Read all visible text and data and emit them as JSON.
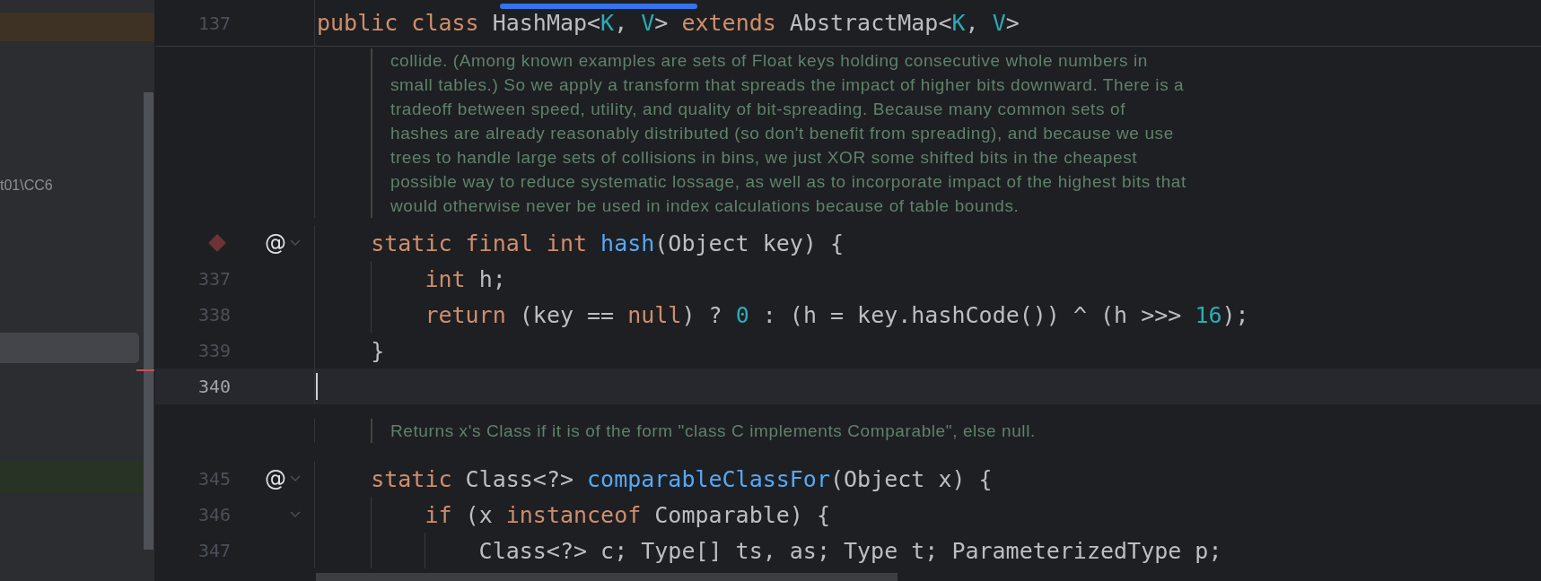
{
  "sidebar": {
    "path_text": "t01\\CC6"
  },
  "editor": {
    "sticky_header": {
      "number": "137",
      "tokens": [
        {
          "t": "public class ",
          "kind": "kw"
        },
        {
          "t": "HashMap<",
          "kind": "plain"
        },
        {
          "t": "K",
          "kind": "num"
        },
        {
          "t": ", ",
          "kind": "plain"
        },
        {
          "t": "V",
          "kind": "num"
        },
        {
          "t": "> ",
          "kind": "plain"
        },
        {
          "t": "extends ",
          "kind": "kw"
        },
        {
          "t": "AbstractMap<",
          "kind": "plain"
        },
        {
          "t": "K",
          "kind": "num"
        },
        {
          "t": ", ",
          "kind": "plain"
        },
        {
          "t": "V",
          "kind": "num"
        },
        {
          "t": ">",
          "kind": "plain"
        }
      ]
    },
    "lines": [
      {
        "kind": "doc",
        "lines": [
          "collide. (Among known examples are sets of Float keys holding consecutive whole numbers in",
          "small tables.) So we apply a transform that spreads the impact of higher bits downward. There is a",
          "tradeoff between speed, utility, and quality of bit-spreading. Because many common sets of",
          "hashes are already reasonably distributed (so don't benefit from spreading), and because we use",
          "trees to handle large sets of collisions in bins, we just XOR some shifted bits in the cheapest",
          "possible way to reduce systematic lossage, as well as to incorporate impact of the highest bits that",
          "would otherwise never be used in index calculations because of table bounds."
        ]
      },
      {
        "kind": "code",
        "breakpoint": true,
        "annotation": "@",
        "fold": true,
        "current": false,
        "tokens": [
          {
            "t": "    static final int ",
            "kind": "kw"
          },
          {
            "t": "hash",
            "kind": "fn"
          },
          {
            "t": "(Object key) {",
            "kind": "plain"
          }
        ]
      },
      {
        "kind": "code",
        "number": "337",
        "breakpoint": false,
        "fold": false,
        "current": false,
        "tokens": [
          {
            "t": "        int ",
            "kind": "kw"
          },
          {
            "t": "h;",
            "kind": "plain"
          }
        ]
      },
      {
        "kind": "code",
        "number": "338",
        "breakpoint": false,
        "fold": false,
        "current": false,
        "tokens": [
          {
            "t": "        return ",
            "kind": "kw"
          },
          {
            "t": "(key == ",
            "kind": "plain"
          },
          {
            "t": "null",
            "kind": "kw"
          },
          {
            "t": ") ? ",
            "kind": "plain"
          },
          {
            "t": "0",
            "kind": "num"
          },
          {
            "t": " : (h = key.hashCode()) ^ (h >>> ",
            "kind": "plain"
          },
          {
            "t": "16",
            "kind": "num"
          },
          {
            "t": ");",
            "kind": "plain"
          }
        ]
      },
      {
        "kind": "code",
        "number": "339",
        "breakpoint": false,
        "fold": false,
        "current": false,
        "tokens": [
          {
            "t": "    }",
            "kind": "plain"
          }
        ]
      },
      {
        "kind": "code",
        "number": "340",
        "breakpoint": false,
        "fold": false,
        "current": true
      },
      {
        "kind": "doc",
        "lines": [
          "Returns x's Class if it is of the form \"class C implements Comparable\", else null."
        ]
      },
      {
        "kind": "code",
        "number": "345",
        "breakpoint": false,
        "annotation": "@",
        "fold": true,
        "current": false,
        "tokens": [
          {
            "t": "    static ",
            "kind": "kw"
          },
          {
            "t": "Class<?> ",
            "kind": "plain"
          },
          {
            "t": "comparableClassFor",
            "kind": "fn"
          },
          {
            "t": "(Object x) {",
            "kind": "plain"
          }
        ]
      },
      {
        "kind": "code",
        "number": "346",
        "breakpoint": false,
        "fold": true,
        "current": false,
        "tokens": [
          {
            "t": "        if ",
            "kind": "kw"
          },
          {
            "t": "(x ",
            "kind": "plain"
          },
          {
            "t": "instanceof ",
            "kind": "kw"
          },
          {
            "t": "Comparable) {",
            "kind": "plain"
          }
        ]
      },
      {
        "kind": "code",
        "number": "347",
        "breakpoint": false,
        "fold": false,
        "current": false,
        "tokens": [
          {
            "t": "            Class<?> c; Type[] ts, as; Type t; ParameterizedType p;",
            "kind": "plain"
          }
        ]
      }
    ]
  }
}
